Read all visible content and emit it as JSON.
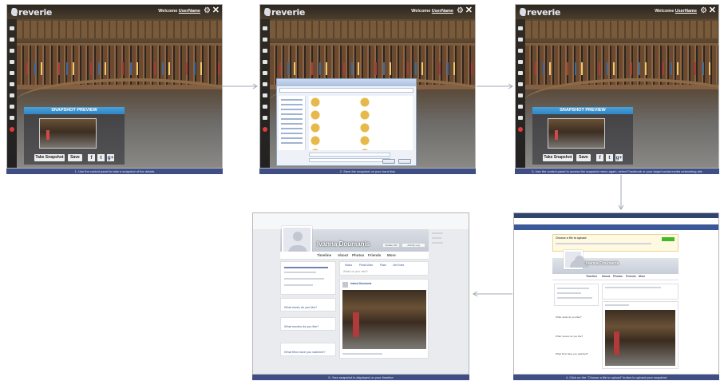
{
  "app": {
    "logo": "reverie",
    "welcome": "Welcome",
    "username": "UserName"
  },
  "snapshot": {
    "header": "SNAPSHOT PREVIEW",
    "take_label": "Take Snapshot",
    "save_label": "Save",
    "share_icons": [
      {
        "name": "facebook-icon",
        "glyph": "f"
      },
      {
        "name": "twitter-icon",
        "glyph": "t"
      },
      {
        "name": "googleplus-icon",
        "glyph": "g+"
      }
    ]
  },
  "captions": [
    "1. Use the control panel to take a snapshot of the details",
    "2. Save the snapshot on your hard disk",
    "3. Use the control panel to access the snapshot menu again, select Facebook or your target social media networking site",
    "4. Click on the \"Choose a file to upload\" button to upload your snapshot",
    "5. Your snapshot is displayed on your timeline"
  ],
  "facebook": {
    "name": "Ivanna Doumanis",
    "tabs": [
      "Timeline",
      "About",
      "Photos",
      "Friends",
      "More"
    ],
    "composer_tabs": [
      "Status",
      "Photo/Video",
      "Place",
      "Life Event"
    ],
    "composer_placeholder": "What's on your mind?",
    "prompt_1": "What music do you like?",
    "prompt_2": "What movies do you like?",
    "prompt_3": "What films have you watched?",
    "post_author": "Ivanna Doumanis",
    "upload_title": "Choose a file to upload",
    "update_info_label": "Update Info",
    "activity_log_label": "Activity Log"
  },
  "colors": {
    "snapshot_header": "#2e86c6",
    "caption_bar": "#3f4f86",
    "facebook_blue": "#3b5998"
  }
}
